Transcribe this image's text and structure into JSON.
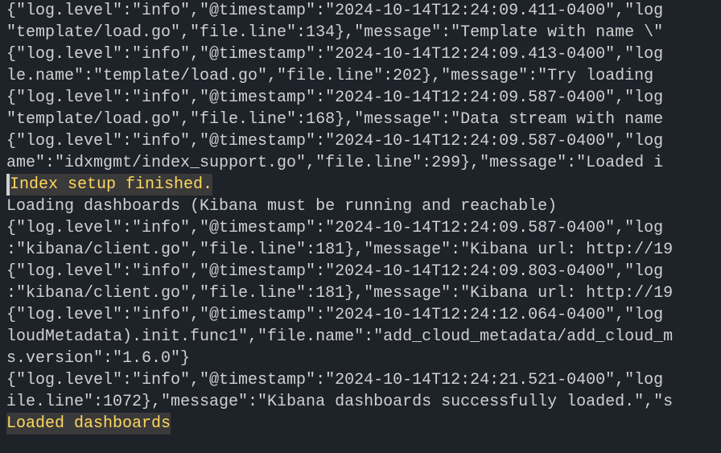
{
  "lines": {
    "l0": "{\"log.level\":\"info\",\"@timestamp\":\"2024-10-14T12:24:09.411-0400\",\"log",
    "l1": "\"template/load.go\",\"file.line\":134},\"message\":\"Template with name \\\"",
    "l2": "{\"log.level\":\"info\",\"@timestamp\":\"2024-10-14T12:24:09.413-0400\",\"log",
    "l3": "le.name\":\"template/load.go\",\"file.line\":202},\"message\":\"Try loading ",
    "l4": "{\"log.level\":\"info\",\"@timestamp\":\"2024-10-14T12:24:09.587-0400\",\"log",
    "l5": "\"template/load.go\",\"file.line\":168},\"message\":\"Data stream with name ",
    "l6": "{\"log.level\":\"info\",\"@timestamp\":\"2024-10-14T12:24:09.587-0400\",\"log",
    "l7": "ame\":\"idxmgmt/index_support.go\",\"file.line\":299},\"message\":\"Loaded i",
    "l8": "Index setup finished.",
    "l9": "Loading dashboards (Kibana must be running and reachable)",
    "l10": "{\"log.level\":\"info\",\"@timestamp\":\"2024-10-14T12:24:09.587-0400\",\"log",
    "l11": ":\"kibana/client.go\",\"file.line\":181},\"message\":\"Kibana url: http://19",
    "l12": "{\"log.level\":\"info\",\"@timestamp\":\"2024-10-14T12:24:09.803-0400\",\"log",
    "l13": ":\"kibana/client.go\",\"file.line\":181},\"message\":\"Kibana url: http://19",
    "l14": "{\"log.level\":\"info\",\"@timestamp\":\"2024-10-14T12:24:12.064-0400\",\"log",
    "l15": "loudMetadata).init.func1\",\"file.name\":\"add_cloud_metadata/add_cloud_m",
    "l16": "s.version\":\"1.6.0\"}",
    "l17": "{\"log.level\":\"info\",\"@timestamp\":\"2024-10-14T12:24:21.521-0400\",\"log",
    "l18": "ile.line\":1072},\"message\":\"Kibana dashboards successfully loaded.\",\"s",
    "l19": "Loaded dashboards"
  }
}
